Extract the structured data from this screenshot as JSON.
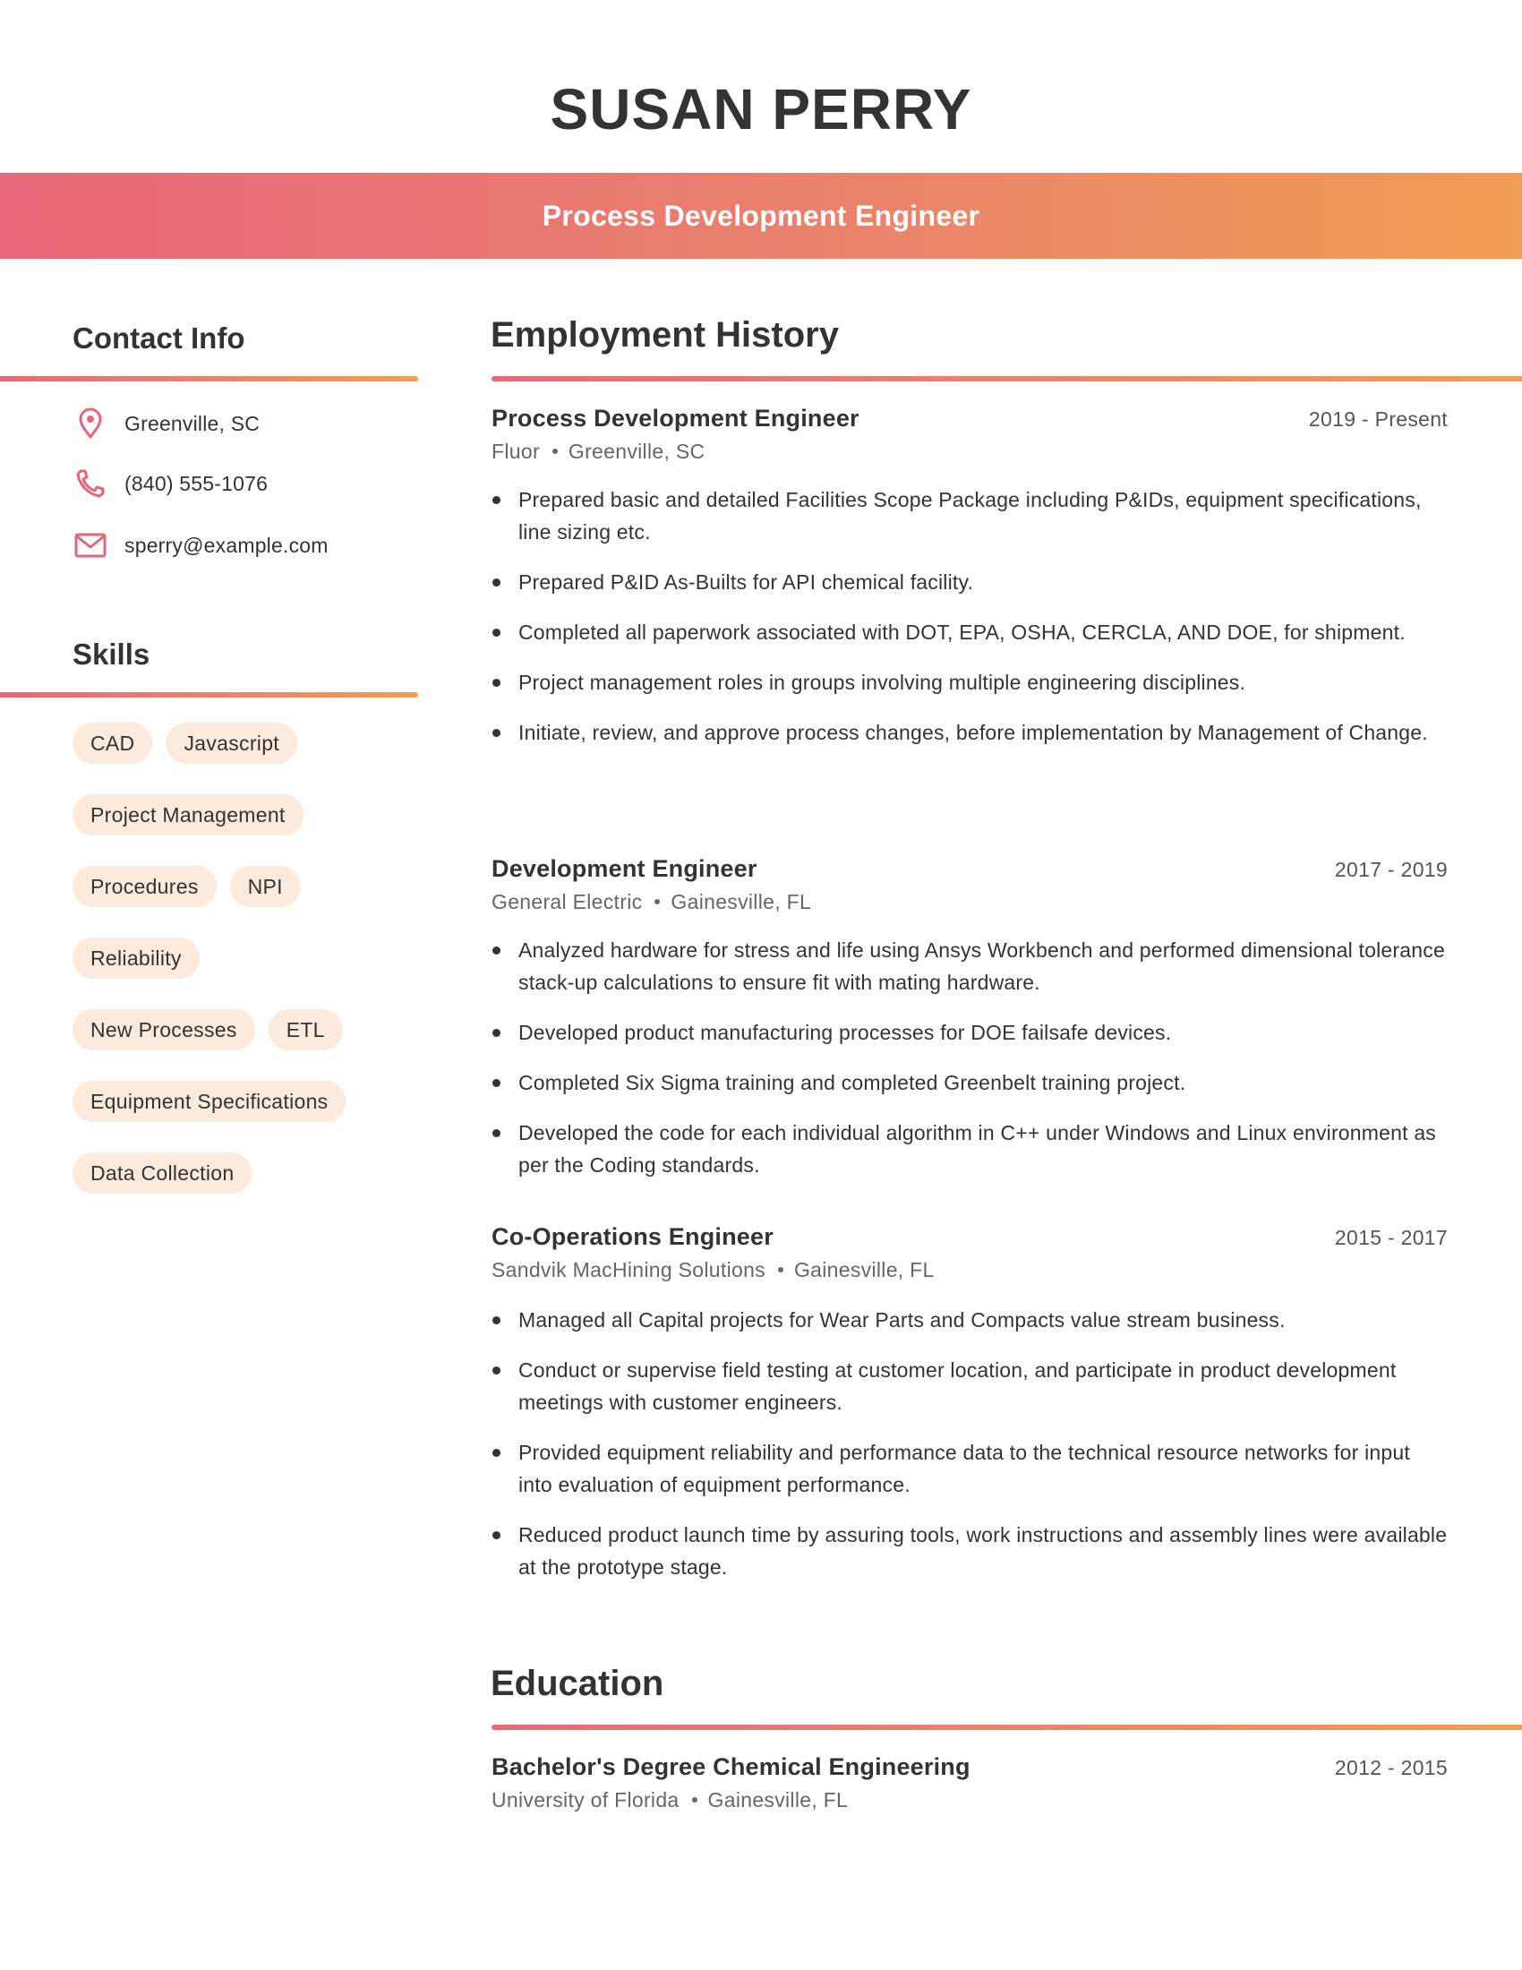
{
  "header": {
    "name": "SUSAN PERRY",
    "job_title": "Process Development Engineer"
  },
  "colors": {
    "gradient_start": "#E7687A",
    "gradient_end": "#F09D55",
    "icon": "#E2677A",
    "chip_bg": "#FCEADC",
    "text": "#333333"
  },
  "contact": {
    "heading": "Contact Info",
    "items": [
      {
        "icon": "location-pin-icon",
        "text": "Greenville, SC"
      },
      {
        "icon": "phone-icon",
        "text": "(840) 555-1076"
      },
      {
        "icon": "mail-icon",
        "text": "sperry@example.com"
      }
    ]
  },
  "skills": {
    "heading": "Skills",
    "items": [
      "CAD",
      "Javascript",
      "Project Management",
      "Procedures",
      "NPI",
      "Reliability",
      "New Processes",
      "ETL",
      "Equipment Specifications",
      "Data Collection"
    ]
  },
  "employment": {
    "heading": "Employment History",
    "jobs": [
      {
        "title": "Process Development Engineer",
        "dates": "2019 - Present",
        "company": "Fluor",
        "location": "Greenville, SC",
        "bullets": [
          "Prepared basic and detailed Facilities Scope Package including P&IDs, equipment specifications, line sizing etc.",
          "Prepared P&ID As-Builts for API chemical facility.",
          "Completed all paperwork associated with DOT, EPA, OSHA, CERCLA, AND DOE, for shipment.",
          "Project management roles in groups involving multiple engineering disciplines.",
          "Initiate, review, and approve process changes, before implementation by Management of Change."
        ]
      },
      {
        "title": "Development Engineer",
        "dates": "2017 - 2019",
        "company": "General Electric",
        "location": "Gainesville, FL",
        "bullets": [
          "Analyzed hardware for stress and life using Ansys Workbench and performed dimensional tolerance stack-up calculations to ensure fit with mating hardware.",
          "Developed product manufacturing processes for DOE failsafe devices.",
          "Completed Six Sigma training and completed Greenbelt training project.",
          "Developed the code for each individual algorithm in C++ under Windows and Linux environment as per the Coding standards."
        ]
      },
      {
        "title": "Co-Operations Engineer",
        "dates": "2015 - 2017",
        "company": "Sandvik MacHining Solutions",
        "location": "Gainesville, FL",
        "bullets": [
          "Managed all Capital projects for Wear Parts and Compacts value stream business.",
          "Conduct or supervise field testing at customer location, and participate in product development meetings with customer engineers.",
          "Provided equipment reliability and performance data to the technical resource networks for input into evaluation of equipment performance.",
          "Reduced product launch time by assuring tools, work instructions and assembly lines were available at the prototype stage."
        ]
      }
    ]
  },
  "education": {
    "heading": "Education",
    "items": [
      {
        "degree": "Bachelor's Degree Chemical Engineering",
        "dates": "2012 - 2015",
        "school": "University of Florida",
        "location": "Gainesville, FL"
      }
    ]
  }
}
